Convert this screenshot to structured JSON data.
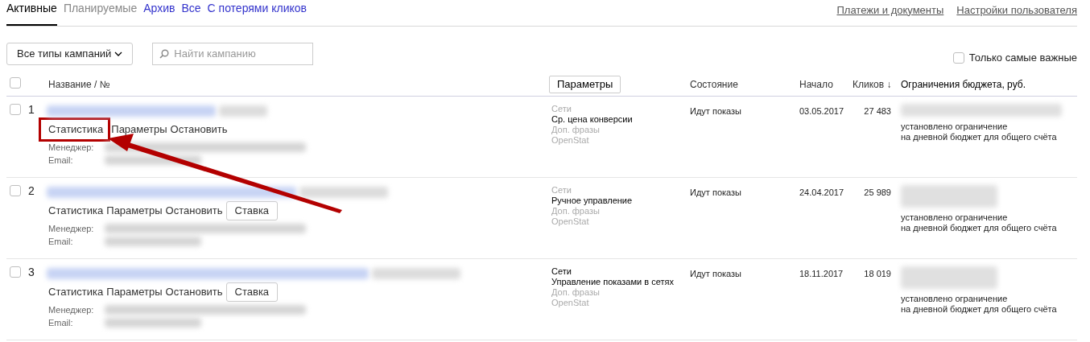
{
  "tabs": [
    {
      "label": "Активные",
      "selected": true,
      "kind": "tab"
    },
    {
      "label": "Планируемые",
      "selected": false,
      "kind": "muted"
    },
    {
      "label": "Архив",
      "selected": false,
      "kind": "tab"
    },
    {
      "label": "Все",
      "selected": false,
      "kind": "tab"
    },
    {
      "label": "С потерями кликов",
      "selected": false,
      "kind": "tab"
    }
  ],
  "top_links": [
    "Платежи и документы",
    "Настройки пользователя"
  ],
  "filter": {
    "label": "Все типы кампаний"
  },
  "search": {
    "placeholder": "Найти кампанию"
  },
  "important_only": {
    "label": "Только самые важные",
    "checked": false
  },
  "columns": {
    "select_all_checked": false,
    "name": "Название / №",
    "params_button": "Параметры",
    "state": "Состояние",
    "start": "Начало",
    "clicks": "Кликов ↓",
    "budget": "Ограничения бюджета, руб."
  },
  "campaigns": [
    {
      "checked": false,
      "number": "1",
      "actions": [
        {
          "label": "Статистика",
          "kind": "link",
          "highlighted": true
        },
        {
          "label": "Параметры",
          "kind": "link",
          "highlighted": false
        },
        {
          "label": "Остановить",
          "kind": "link",
          "highlighted": false
        }
      ],
      "manager_label": "Менеджер:",
      "email_label": "Email:",
      "strategy": [
        {
          "text": "Сети",
          "dim": true
        },
        {
          "text": "Ср. цена конверсии",
          "dim": false
        },
        {
          "text": "Доп. фразы",
          "dim": true
        },
        {
          "text": "OpenStat",
          "dim": true
        }
      ],
      "state": "Идут показы",
      "start": "03.05.2017",
      "clicks": "27 483",
      "budget_note": "установлено ограничение\nна дневной бюджет для общего счёта"
    },
    {
      "checked": false,
      "number": "2",
      "actions": [
        {
          "label": "Статистика",
          "kind": "link",
          "highlighted": false
        },
        {
          "label": "Параметры",
          "kind": "link",
          "highlighted": false
        },
        {
          "label": "Остановить",
          "kind": "link",
          "highlighted": false
        },
        {
          "label": "Ставка",
          "kind": "button",
          "highlighted": false
        }
      ],
      "manager_label": "Менеджер:",
      "email_label": "Email:",
      "strategy": [
        {
          "text": "Сети",
          "dim": true
        },
        {
          "text": "Ручное управление",
          "dim": false
        },
        {
          "text": "Доп. фразы",
          "dim": true
        },
        {
          "text": "OpenStat",
          "dim": true
        }
      ],
      "state": "Идут показы",
      "start": "24.04.2017",
      "clicks": "25 989",
      "budget_note": "установлено ограничение\nна дневной бюджет для общего счёта"
    },
    {
      "checked": false,
      "number": "3",
      "actions": [
        {
          "label": "Статистика",
          "kind": "link",
          "highlighted": false
        },
        {
          "label": "Параметры",
          "kind": "link",
          "highlighted": false
        },
        {
          "label": "Остановить",
          "kind": "link",
          "highlighted": false
        },
        {
          "label": "Ставка",
          "kind": "button",
          "highlighted": false
        }
      ],
      "manager_label": "Менеджер:",
      "email_label": "Email:",
      "strategy": [
        {
          "text": "Сети",
          "dim": false
        },
        {
          "text": "Управление показами в сетях",
          "dim": false
        },
        {
          "text": "Доп. фразы",
          "dim": true
        },
        {
          "text": "OpenStat",
          "dim": true
        }
      ],
      "state": "Идут показы",
      "start": "18.11.2017",
      "clicks": "18 019",
      "budget_note": "установлено ограничение\nна дневной бюджет для общего счёта"
    }
  ]
}
